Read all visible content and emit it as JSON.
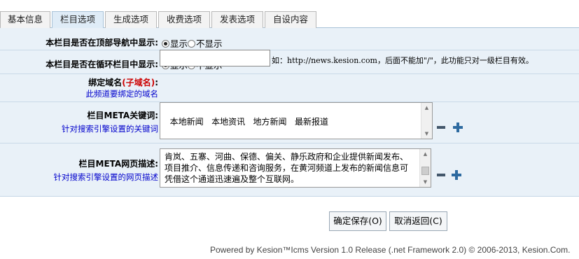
{
  "tabs": [
    "基本信息",
    "栏目选项",
    "生成选项",
    "收费选项",
    "发表选项",
    "自设内容"
  ],
  "active_tab": "栏目选项",
  "rows": {
    "top_nav": {
      "label": "本栏目是否在顶部导航中显示:",
      "options": [
        "显示",
        "不显示"
      ],
      "selected": "显示"
    },
    "loop_nav": {
      "label": "本栏目是否在循环栏目中显示:",
      "options": [
        "显示",
        "不显示"
      ],
      "selected": "显示"
    },
    "domain": {
      "label": "绑定域名",
      "label_red": "(子域名)",
      "label_colon": ":",
      "sub": "此频道要绑定的域名",
      "value": "",
      "hint": "如：http://news.kesion.com，后面不能加\"/\"，此功能只对一级栏目有效。"
    },
    "meta_keywords": {
      "label": "栏目META关键词:",
      "sub": "针对搜索引擎设置的关键词",
      "value": "本地新闻   本地资讯   地方新闻   最新报道"
    },
    "meta_description": {
      "label": "栏目META网页描述:",
      "sub": "针对搜索引擎设置的网页描述",
      "value": "肯岚、五寨、河曲、保德、偏关、静乐政府和企业提供新闻发布、项目推介、信息传递和咨询服务，在黄河频道上发布的新闻信息可凭借这个通道迅速遍及整个互联网。"
    }
  },
  "buttons": {
    "save": "确定保存(O)",
    "back": "取消返回(C)"
  },
  "footer": "Powered by Kesion™Icms Version 1.0 Release (.net Framework 2.0) © 2006-2013, Kesion.Com."
}
